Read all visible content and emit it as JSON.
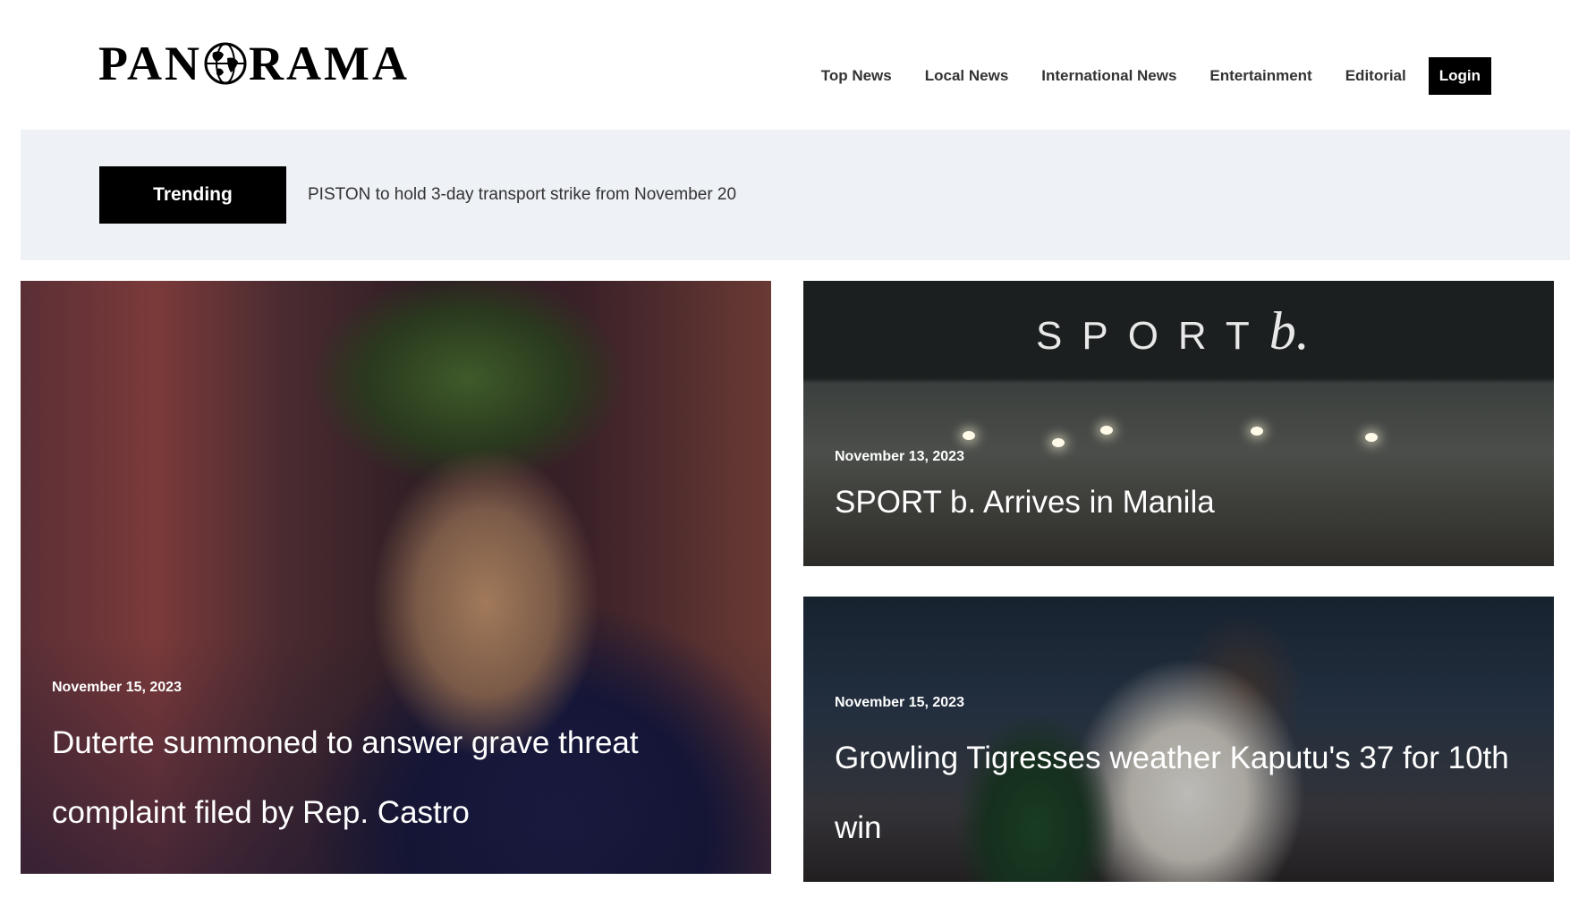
{
  "site": {
    "logo_text_left": "PAN",
    "logo_text_right": "RAMA",
    "logo_icon": "globe-icon"
  },
  "nav": {
    "items": [
      "Top News",
      "Local News",
      "International News",
      "Entertainment",
      "Editorial"
    ],
    "login_label": "Login"
  },
  "trending": {
    "label": "Trending",
    "headline": "PISTON to hold 3-day transport strike from November 20"
  },
  "featured": {
    "main": {
      "date": "November 15, 2023",
      "title": "Duterte summoned to answer grave threat complaint filed by Rep. Castro"
    },
    "sport": {
      "date": "November 13, 2023",
      "title": "SPORT b. Arrives in Manila",
      "sign_text": "SPORT",
      "sign_b": "b."
    },
    "basketball": {
      "date": "November 15, 2023",
      "title": "Growling Tigresses weather Kaputu's 37 for 10th win"
    }
  },
  "colors": {
    "accent": "#000000",
    "trending_bg": "#eef1f6",
    "nav_text": "#333333"
  }
}
